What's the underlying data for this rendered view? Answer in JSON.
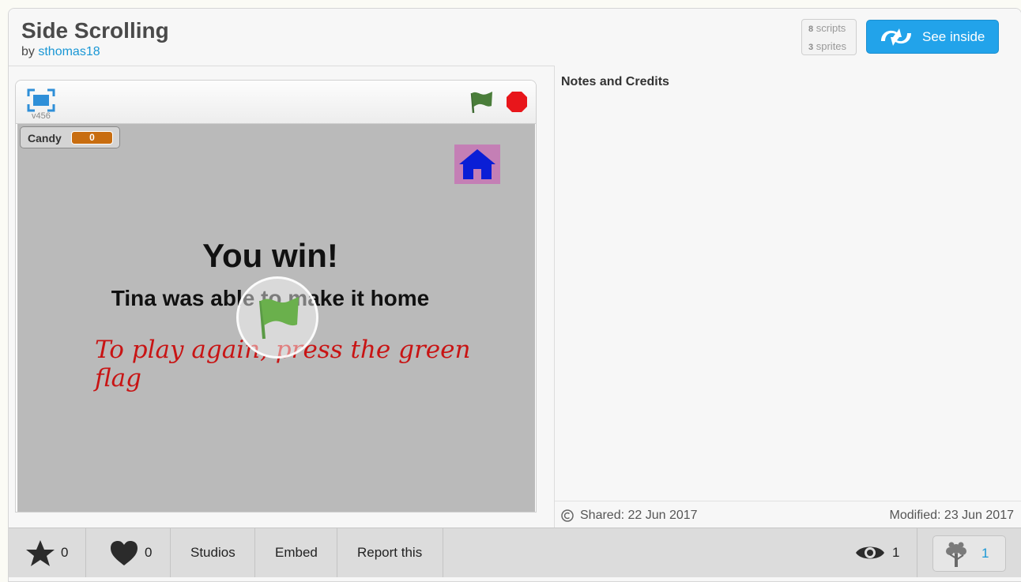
{
  "header": {
    "title": "Side Scrolling",
    "by_label": "by",
    "author": "sthomas18",
    "scripts_count": "8",
    "scripts_label": "scripts",
    "sprites_count": "3",
    "sprites_label": "sprites",
    "see_inside_label": "See inside"
  },
  "player": {
    "version": "v456",
    "fullscreen_icon": "fullscreen-icon",
    "green_flag_icon": "green-flag-icon",
    "stop_icon": "stop-icon",
    "variable_monitor": {
      "label": "Candy",
      "value": "0"
    },
    "stage_text": {
      "title": "You win!",
      "subtitle": "Tina was able to make it home",
      "instruction": "To play again, press the green flag"
    },
    "colors": {
      "stage_bg": "#bababa",
      "flag": "#4a7d3a",
      "stop": "#e8161b",
      "monitor_value": "#c86d10"
    }
  },
  "notes": {
    "title": "Notes and Credits",
    "shared": "Shared: 22 Jun 2017",
    "modified": "Modified: 23 Jun 2017"
  },
  "actions": {
    "favorites_count": "0",
    "loves_count": "0",
    "studios_label": "Studios",
    "embed_label": "Embed",
    "report_label": "Report this",
    "views_count": "1",
    "remixes_count": "1"
  },
  "colors": {
    "accent": "#22a3ea",
    "link": "#1a97d5",
    "action_bar": "#dcdcdc"
  }
}
